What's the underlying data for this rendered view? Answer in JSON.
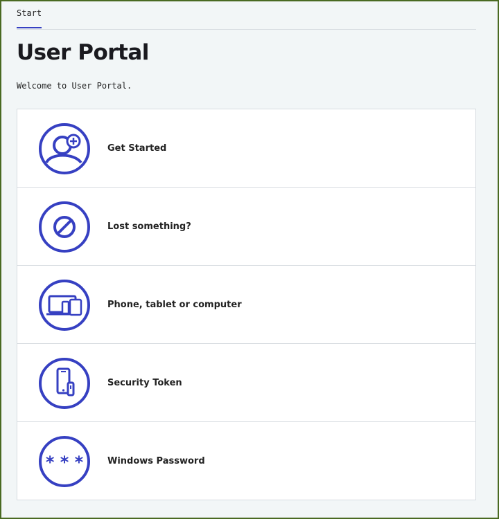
{
  "breadcrumb": {
    "start_label": "Start"
  },
  "header": {
    "title": "User Portal",
    "welcome": "Welcome to User Portal."
  },
  "colors": {
    "accent": "#3640c2",
    "frame": "#4a6a22",
    "background": "#f2f6f7"
  },
  "items": [
    {
      "label": "Get Started",
      "icon": "user-add-icon"
    },
    {
      "label": "Lost something?",
      "icon": "prohibited-icon"
    },
    {
      "label": "Phone, tablet or computer",
      "icon": "devices-icon"
    },
    {
      "label": "Security Token",
      "icon": "security-token-icon"
    },
    {
      "label": "Windows Password",
      "icon": "password-icon"
    }
  ]
}
